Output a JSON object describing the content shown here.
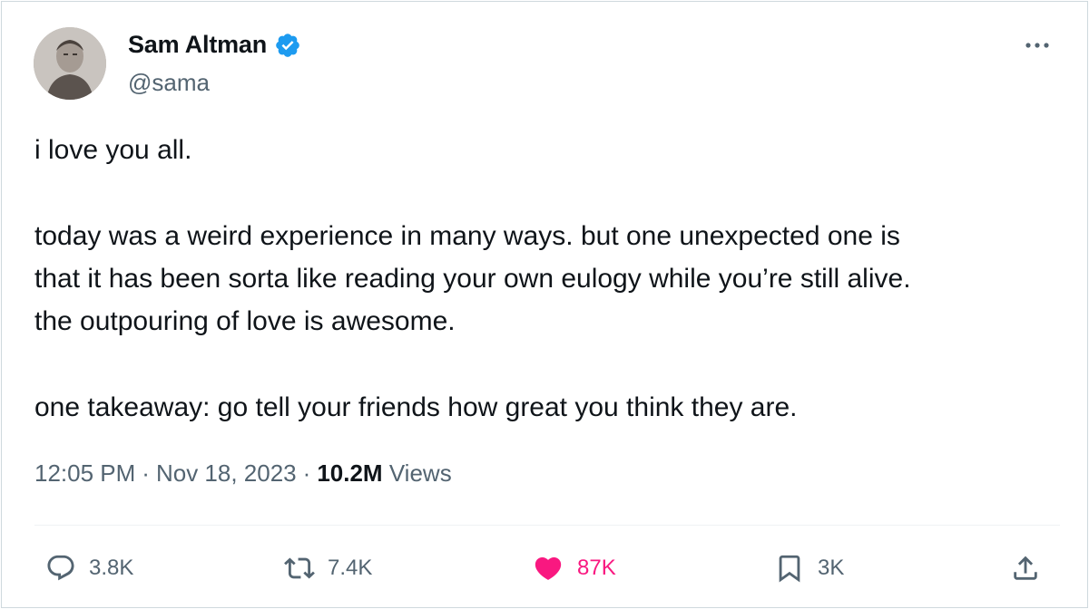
{
  "author": {
    "name": "Sam Altman",
    "handle": "@sama",
    "verified": true,
    "verified_icon": "verified-badge-icon",
    "avatar_icon": "avatar"
  },
  "tweet": {
    "paragraphs": [
      [
        "i love you all."
      ],
      [
        "today was a weird experience in many ways. but one unexpected one is",
        "that it has been sorta like reading your own eulogy while you’re still alive.",
        "the outpouring of love is awesome."
      ],
      [
        "one takeaway: go tell your friends how great you think they are."
      ]
    ]
  },
  "meta": {
    "time": "12:05 PM",
    "separator": "·",
    "date": "Nov 18, 2023",
    "views_count": "10.2M",
    "views_label": "Views"
  },
  "actions": {
    "reply_count": "3.8K",
    "retweet_count": "7.4K",
    "like_count": "87K",
    "bookmark_count": "3K",
    "icons": [
      "reply-icon",
      "retweet-icon",
      "heart-icon",
      "bookmark-icon",
      "share-icon"
    ]
  },
  "colors": {
    "verified": "#1d9bf0",
    "like_active": "#f91880",
    "secondary_text": "#536471",
    "primary_text": "#0f1419",
    "border": "#cfd9de"
  }
}
